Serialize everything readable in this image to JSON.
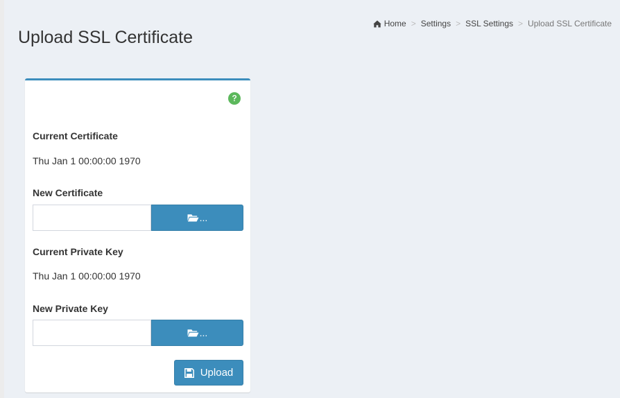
{
  "header": {
    "title": "Upload SSL Certificate"
  },
  "breadcrumb": {
    "items": [
      {
        "label": "Home",
        "icon": "home-icon"
      },
      {
        "label": "Settings"
      },
      {
        "label": "SSL Settings"
      },
      {
        "label": "Upload SSL Certificate"
      }
    ],
    "separator": ">"
  },
  "form": {
    "help_icon": "question-circle-icon",
    "current_certificate": {
      "label": "Current Certificate",
      "value": "Thu Jan 1 00:00:00 1970"
    },
    "new_certificate": {
      "label": "New Certificate",
      "value": "",
      "browse_icon": "folder-open-icon",
      "browse_label": "..."
    },
    "current_private_key": {
      "label": "Current Private Key",
      "value": "Thu Jan 1 00:00:00 1970"
    },
    "new_private_key": {
      "label": "New Private Key",
      "value": "",
      "browse_icon": "folder-open-icon",
      "browse_label": "..."
    },
    "upload_button": {
      "label": "Upload",
      "icon": "floppy-disk-icon"
    }
  },
  "colors": {
    "primary": "#3c8dbc",
    "help_icon": "#5cb85c",
    "background": "#ecf0f5"
  }
}
